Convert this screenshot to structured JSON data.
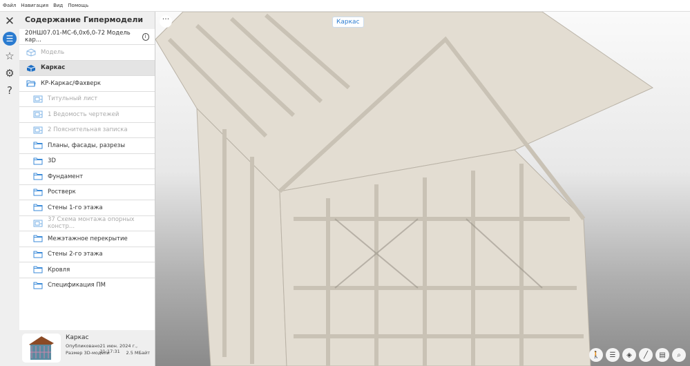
{
  "menu": [
    "Файл",
    "Навигация",
    "Вид",
    "Помощь"
  ],
  "panel": {
    "title": "Содержание Гипермодели",
    "model_name": "20НШ07.01-МС-6,0х6,0-72 Модель кар..."
  },
  "items": [
    {
      "label": "Модель",
      "icon": "cube-outline-icon",
      "state": "dim",
      "level": 0
    },
    {
      "label": "Каркас",
      "icon": "cube-filled-icon",
      "state": "selected",
      "level": 0
    },
    {
      "label": "КР-Каркас/Фахверк",
      "icon": "folder-open-icon",
      "state": "normal",
      "level": 0
    },
    {
      "label": "Титульный лист",
      "icon": "sheet-icon",
      "state": "dim",
      "level": 1
    },
    {
      "label": "1 Ведомость чертежей",
      "icon": "sheet-icon",
      "state": "dim",
      "level": 1
    },
    {
      "label": "2 Пояснительная записка",
      "icon": "sheet-icon",
      "state": "dim",
      "level": 1
    },
    {
      "label": "Планы, фасады, разрезы",
      "icon": "folder-icon",
      "state": "normal",
      "level": 1
    },
    {
      "label": "3D",
      "icon": "folder-icon",
      "state": "normal",
      "level": 1
    },
    {
      "label": "Фундамент",
      "icon": "folder-icon",
      "state": "normal",
      "level": 1
    },
    {
      "label": "Ростверк",
      "icon": "folder-icon",
      "state": "normal",
      "level": 1
    },
    {
      "label": "Стены 1-го этажа",
      "icon": "folder-icon",
      "state": "normal",
      "level": 1
    },
    {
      "label": "37 Схема монтажа опорных констр...",
      "icon": "sheet-icon",
      "state": "dim",
      "level": 1
    },
    {
      "label": "Межэтажное перекрытие",
      "icon": "folder-icon",
      "state": "normal",
      "level": 1
    },
    {
      "label": "Стены 2-го этажа",
      "icon": "folder-icon",
      "state": "normal",
      "level": 1
    },
    {
      "label": "Кровля",
      "icon": "folder-icon",
      "state": "normal",
      "level": 1
    },
    {
      "label": "Спецификация ПМ",
      "icon": "folder-icon",
      "state": "normal",
      "level": 1
    }
  ],
  "card": {
    "title": "Каркас",
    "published_label": "Опубликовано",
    "published": "21 июн. 2024 г., 21:17:31",
    "size_label": "Размер 3D-модели",
    "size": "2.5 МБайт"
  },
  "viewport": {
    "badge": "Каркас",
    "more": "···"
  },
  "colors": {
    "accent": "#2a7bd0",
    "frame": "#e3ddd2"
  }
}
